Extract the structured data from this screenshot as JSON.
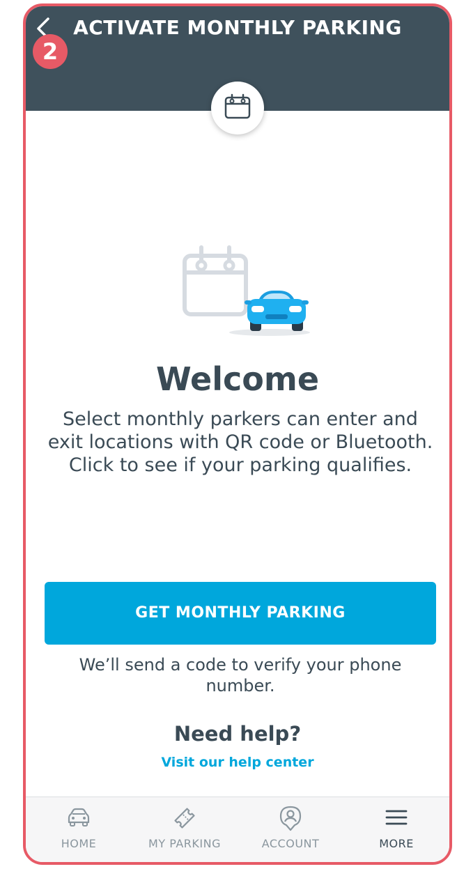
{
  "header": {
    "title": "ACTIVATE MONTHLY PARKING",
    "step_number": "2",
    "colors": {
      "background": "#3f515c",
      "step_badge": "#e75a66"
    }
  },
  "main": {
    "welcome_title": "Welcome",
    "description": "Select monthly parkers can enter and exit locations with QR code or Bluetooth. Click to see if your parking qualifies.",
    "cta_label": "GET MONTHLY PARKING",
    "cta_note": "We’ll send a code to verify your phone number.",
    "help_title": "Need help?",
    "help_link": "Visit our help center",
    "accent_color": "#00a7dc"
  },
  "tabbar": {
    "items": [
      {
        "label": "HOME",
        "icon": "car-icon",
        "active": false
      },
      {
        "label": "MY PARKING",
        "icon": "ticket-icon",
        "active": false
      },
      {
        "label": "ACCOUNT",
        "icon": "user-pin-icon",
        "active": false
      },
      {
        "label": "MORE",
        "icon": "menu-icon",
        "active": true
      }
    ]
  }
}
